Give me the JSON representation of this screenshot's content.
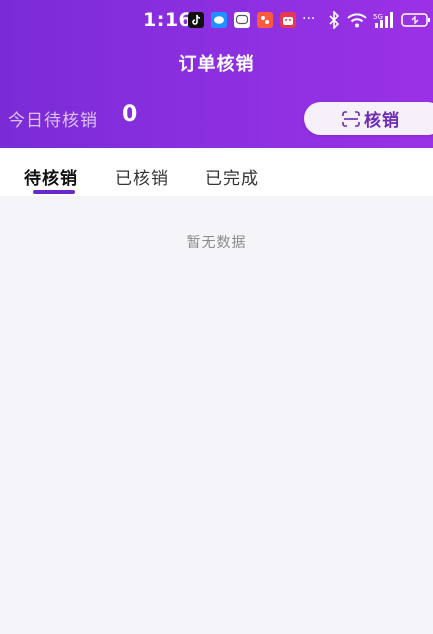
{
  "status_bar": {
    "time": "1:16",
    "overflow": "···",
    "icons": [
      "tiktok-icon",
      "message-icon",
      "chat-icon",
      "app-icon",
      "shop-icon",
      "bluetooth-icon",
      "wifi-icon",
      "signal-icon",
      "battery-icon"
    ]
  },
  "header": {
    "title": "订单核销",
    "today_label": "今日待核销",
    "today_count": "0",
    "verify_button": "核销"
  },
  "tabs": [
    {
      "label": "待核销",
      "active": true
    },
    {
      "label": "已核销",
      "active": false
    },
    {
      "label": "已完成",
      "active": false
    }
  ],
  "content": {
    "empty_text": "暂无数据"
  },
  "colors": {
    "header_start": "#7a2bd6",
    "header_end": "#9b31e6",
    "accent": "#6a28c8",
    "background": "#f5f4f9"
  }
}
